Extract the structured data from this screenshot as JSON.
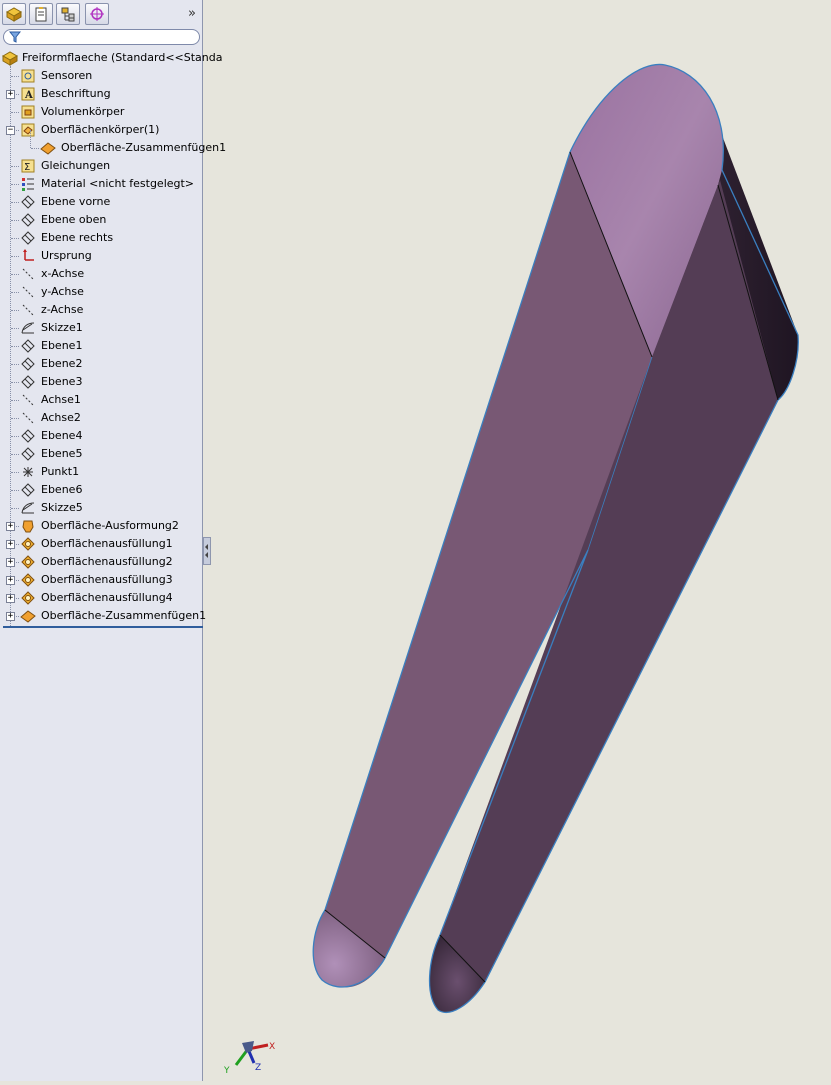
{
  "panel": {
    "tabs": [
      {
        "name": "feature-manager-tab",
        "icon": "feature-manager-icon"
      },
      {
        "name": "property-manager-tab",
        "icon": "property-manager-icon"
      },
      {
        "name": "configuration-manager-tab",
        "icon": "configuration-manager-icon"
      },
      {
        "name": "dimxpert-manager-tab",
        "icon": "dimxpert-icon"
      }
    ],
    "expand_glyph": "»",
    "filter_icon": "filter-icon",
    "tree": {
      "root": "Freiformflaeche  (Standard<<Standa",
      "items": [
        {
          "label": "Sensoren",
          "icon": "sensor-icon",
          "expand": null
        },
        {
          "label": "Beschriftung",
          "icon": "annotation-icon",
          "expand": "+"
        },
        {
          "label": "Volumenkörper",
          "icon": "solid-body-icon",
          "expand": null
        },
        {
          "label": "Oberflächenkörper(1)",
          "icon": "surface-body-icon",
          "expand": "-"
        },
        {
          "label": "Oberfläche-Zusammenfügen1",
          "icon": "surface-knit-icon",
          "expand": null,
          "child": true
        },
        {
          "label": "Gleichungen",
          "icon": "equation-icon",
          "expand": null
        },
        {
          "label": "Material <nicht festgelegt>",
          "icon": "material-icon",
          "expand": null
        },
        {
          "label": "Ebene vorne",
          "icon": "plane-icon",
          "expand": null
        },
        {
          "label": "Ebene oben",
          "icon": "plane-icon",
          "expand": null
        },
        {
          "label": "Ebene rechts",
          "icon": "plane-icon",
          "expand": null
        },
        {
          "label": "Ursprung",
          "icon": "origin-icon",
          "expand": null
        },
        {
          "label": "x-Achse",
          "icon": "axis-icon",
          "expand": null
        },
        {
          "label": "y-Achse",
          "icon": "axis-icon",
          "expand": null
        },
        {
          "label": "z-Achse",
          "icon": "axis-icon",
          "expand": null
        },
        {
          "label": "Skizze1",
          "icon": "sketch-icon",
          "expand": null
        },
        {
          "label": "Ebene1",
          "icon": "plane-icon",
          "expand": null
        },
        {
          "label": "Ebene2",
          "icon": "plane-icon",
          "expand": null
        },
        {
          "label": "Ebene3",
          "icon": "plane-icon",
          "expand": null
        },
        {
          "label": "Achse1",
          "icon": "axis-icon",
          "expand": null
        },
        {
          "label": "Achse2",
          "icon": "axis-icon",
          "expand": null
        },
        {
          "label": "Ebene4",
          "icon": "plane-icon",
          "expand": null
        },
        {
          "label": "Ebene5",
          "icon": "plane-icon",
          "expand": null
        },
        {
          "label": "Punkt1",
          "icon": "point-icon",
          "expand": null
        },
        {
          "label": "Ebene6",
          "icon": "plane-icon",
          "expand": null
        },
        {
          "label": "Skizze5",
          "icon": "sketch-icon",
          "expand": null
        },
        {
          "label": "Oberfläche-Ausformung2",
          "icon": "surface-loft-icon",
          "expand": "+"
        },
        {
          "label": "Oberflächenausfüllung1",
          "icon": "surface-fill-icon",
          "expand": "+"
        },
        {
          "label": "Oberflächenausfüllung2",
          "icon": "surface-fill-icon",
          "expand": "+"
        },
        {
          "label": "Oberflächenausfüllung3",
          "icon": "surface-fill-icon",
          "expand": "+"
        },
        {
          "label": "Oberflächenausfüllung4",
          "icon": "surface-fill-icon",
          "expand": "+"
        },
        {
          "label": "Oberfläche-Zusammenfügen1",
          "icon": "surface-knit-icon",
          "expand": "+"
        }
      ]
    }
  },
  "viewport": {
    "model_colors": {
      "light": "#a07ba6",
      "mid": "#785874",
      "dark": "#4e3a4f",
      "edge": "#3a7fc0"
    },
    "triad": {
      "x": "X",
      "y": "Y",
      "z": "Z"
    }
  }
}
